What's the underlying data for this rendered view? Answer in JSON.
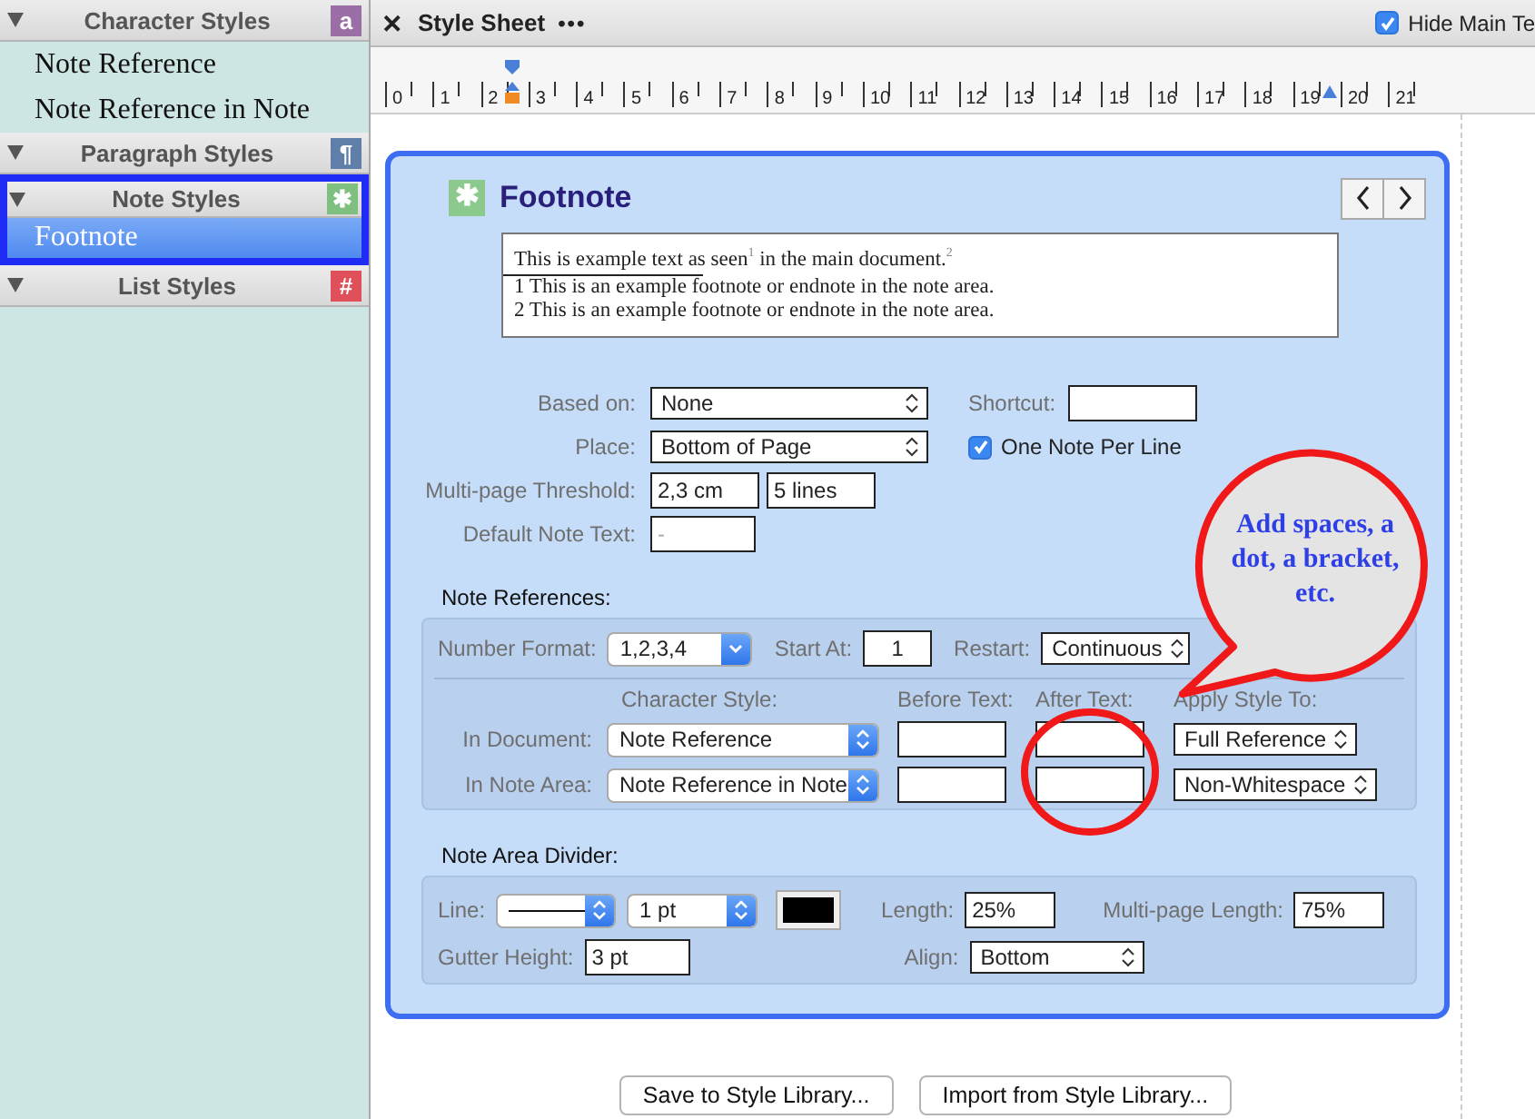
{
  "sidebar": {
    "sections": [
      {
        "title": "Character Styles",
        "badge": "a",
        "color": "#9b6fa6",
        "outlined": false,
        "items": [
          {
            "label": "Note Reference",
            "selected": false
          },
          {
            "label": "Note Reference in Note",
            "selected": false
          }
        ]
      },
      {
        "title": "Paragraph Styles",
        "badge": "¶",
        "color": "#5f7fa8",
        "outlined": false
      },
      {
        "title": "Note Styles",
        "badge": "✱",
        "color": "#7fbf7f",
        "outlined": true,
        "items": [
          {
            "label": "Footnote",
            "selected": true
          }
        ]
      },
      {
        "title": "List Styles",
        "badge": "#",
        "color": "#e0505a",
        "outlined": false
      }
    ]
  },
  "toolbar": {
    "close": "✕",
    "title": "Style Sheet",
    "more": "•••",
    "hide_main": {
      "label": "Hide Main Te",
      "checked": true
    }
  },
  "ruler": {
    "numbers": [
      "0",
      "1",
      "2",
      "3",
      "4",
      "5",
      "6",
      "7",
      "8",
      "9",
      "10",
      "11",
      "12",
      "13",
      "14",
      "15",
      "16",
      "17",
      "18",
      "19",
      "20",
      "21"
    ]
  },
  "style": {
    "badge": "✱",
    "name": "Footnote"
  },
  "preview": {
    "main": "This is example text as seen$^{1}$ in the main document.$^{2}$",
    "notes": [
      "1 This is an example footnote or endnote in the note area.",
      "2 This is an example footnote or endnote in the note area."
    ]
  },
  "form": {
    "based_on": {
      "label": "Based on:",
      "value": "None"
    },
    "shortcut": {
      "label": "Shortcut:"
    },
    "place": {
      "label": "Place:",
      "value": "Bottom of Page"
    },
    "one_note_per_line": {
      "label": "One Note Per Line",
      "checked": true
    },
    "threshold": {
      "label": "Multi-page Threshold:",
      "length": "2,3 cm",
      "lines": "5 lines"
    },
    "default_note_text": {
      "label": "Default Note Text:",
      "placeholder": "-"
    }
  },
  "note_references": {
    "title": "Note References:",
    "number_format": {
      "label": "Number Format:",
      "value": "1,2,3,4"
    },
    "start_at": {
      "label": "Start At:",
      "value": "1"
    },
    "restart": {
      "label": "Restart:",
      "value": "Continuous"
    },
    "headers": [
      "Character Style:",
      "Before Text:",
      "After Text:",
      "Apply Style To:"
    ],
    "rows": [
      {
        "label": "In Document:",
        "character_style": "Note Reference",
        "apply_to": "Full Reference"
      },
      {
        "label": "In Note Area:",
        "character_style": "Note Reference in Note",
        "apply_to": "Non-Whitespace"
      }
    ]
  },
  "note_area_divider": {
    "title": "Note Area Divider:",
    "line": {
      "label": "Line:"
    },
    "weight": "1 pt",
    "color": "#000000",
    "length": {
      "label": "Length:",
      "value": "25%"
    },
    "multipage_length": {
      "label": "Multi-page Length:",
      "value": "75%"
    },
    "gutter": {
      "label": "Gutter Height:",
      "value": "3 pt"
    },
    "align": {
      "label": "Align:",
      "value": "Bottom"
    }
  },
  "callout": {
    "text": "Add spaces, a dot, a bracket, etc."
  },
  "buttons": [
    "Save to Style Library...",
    "Import from Style Library..."
  ]
}
